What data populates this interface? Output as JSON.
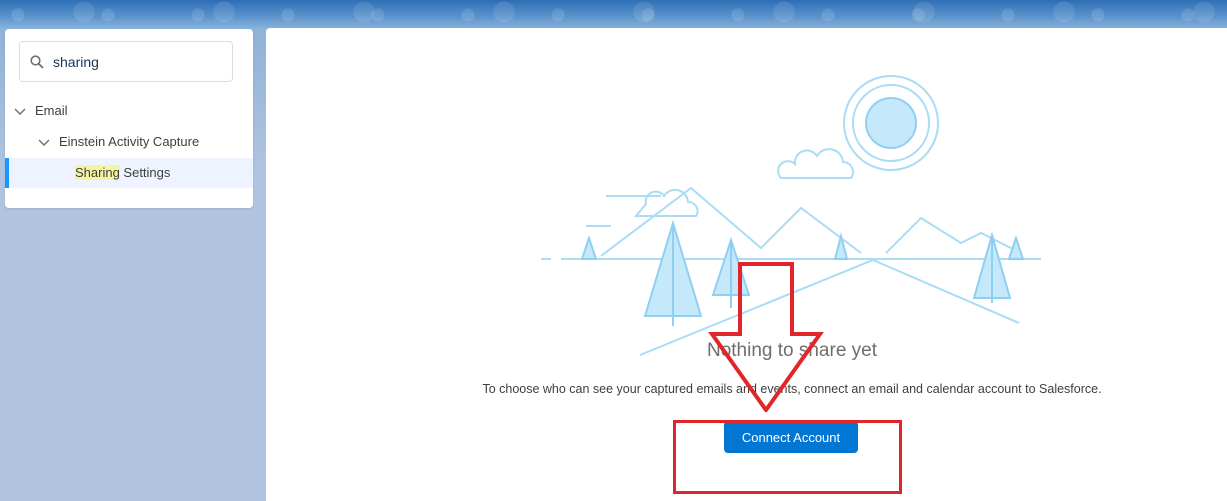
{
  "sidebar": {
    "search": {
      "value": "sharing",
      "icon": "search-icon"
    },
    "tree": [
      {
        "label": "Email",
        "icon": "chevron-down-icon"
      },
      {
        "label": "Einstein Activity Capture",
        "icon": "chevron-down-icon"
      },
      {
        "label_highlight": "Sharing",
        "label_rest": " Settings",
        "selected": true
      }
    ]
  },
  "main": {
    "empty_state": {
      "title": "Nothing to share yet",
      "description": "To choose who can see your captured emails and events, connect an email and calendar account to Salesforce.",
      "button_label": "Connect Account"
    }
  },
  "colors": {
    "brand_button": "#0176d3",
    "selection_accent": "#1b96ff",
    "search_highlight": "#f4f5a2",
    "annotation_red": "#e0262b",
    "illustration_blue": "#8fd0f2"
  }
}
